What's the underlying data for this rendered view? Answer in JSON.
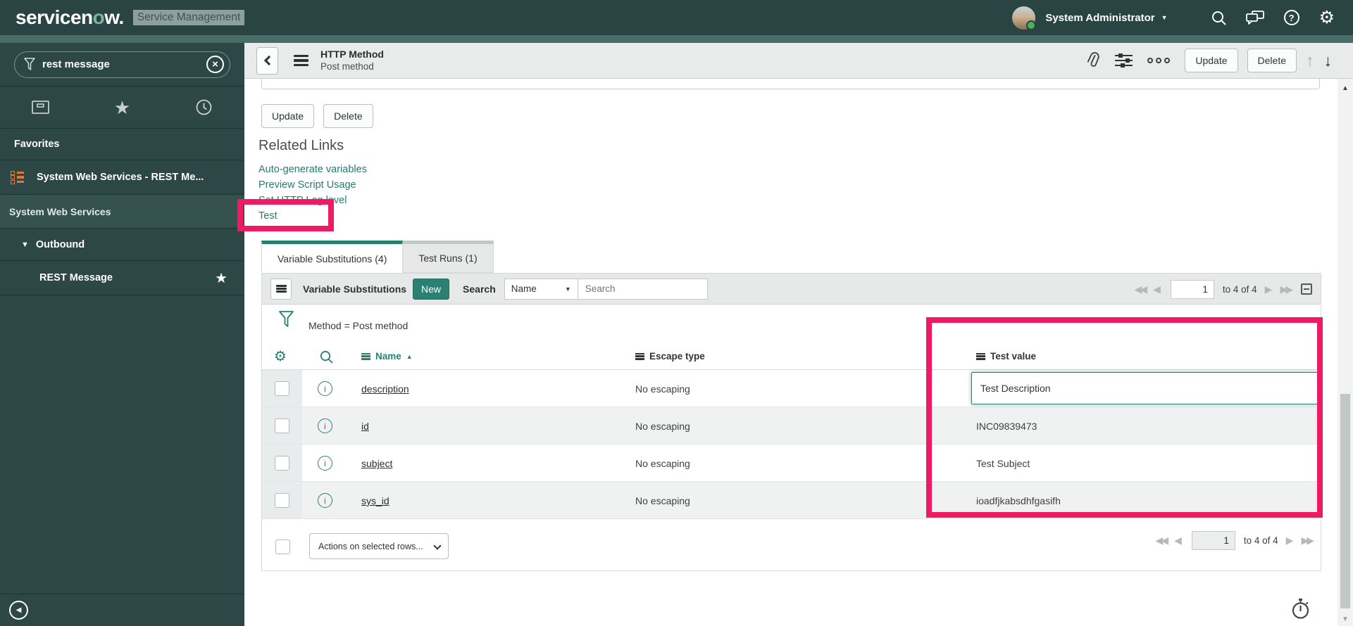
{
  "app": {
    "brand_prefix": "servicen",
    "brand_o": "o",
    "brand_suffix": "w.",
    "product": "Service Management"
  },
  "header": {
    "user": "System Administrator"
  },
  "sidebar": {
    "search_value": "rest message",
    "favorites_title": "Favorites",
    "favorite_item": "System Web Services - REST Me...",
    "section_title": "System Web Services",
    "group_label": "Outbound",
    "item_label": "REST Message"
  },
  "record_header": {
    "title": "HTTP Method",
    "subtitle": "Post method",
    "update": "Update",
    "delete": "Delete"
  },
  "form": {
    "update": "Update",
    "delete": "Delete",
    "related_links_title": "Related Links",
    "links": [
      "Auto-generate variables",
      "Preview Script Usage",
      "Set HTTP Log level",
      "Test"
    ]
  },
  "tabs": {
    "active": "Variable Substitutions (4)",
    "inactive": "Test Runs (1)"
  },
  "list": {
    "title": "Variable Substitutions",
    "new_button": "New",
    "search_label": "Search",
    "search_field": "Name",
    "search_placeholder": "Search",
    "filter_text": "Method = Post method",
    "columns": {
      "name": "Name",
      "escape": "Escape type",
      "value": "Test value"
    },
    "rows": [
      {
        "name": "description",
        "escape": "No escaping",
        "value": "Test Description"
      },
      {
        "name": "id",
        "escape": "No escaping",
        "value": "INC09839473"
      },
      {
        "name": "subject",
        "escape": "No escaping",
        "value": "Test Subject"
      },
      {
        "name": "sys_id",
        "escape": "No escaping",
        "value": "ioadfjkabsdhfgasifh"
      }
    ],
    "pagination": {
      "page": "1",
      "range_text": "to 4 of 4"
    },
    "actions_label": "Actions on selected rows..."
  },
  "icons": {
    "gear": "⚙",
    "star": "★",
    "sort_asc": "▲",
    "caret_down": "▼",
    "dropdown_caret": "▼",
    "back": "‹",
    "up": "↑",
    "down": "↓",
    "first": "◀◀",
    "prev": "◀",
    "next": "▶",
    "last": "▶▶",
    "clear": "×",
    "help": "?",
    "collapse_left": "◀",
    "info": "i"
  },
  "colors": {
    "accent_teal": "#2a8073",
    "annotation_pink": "#ee1a63",
    "banner_bg": "#2a4444"
  }
}
